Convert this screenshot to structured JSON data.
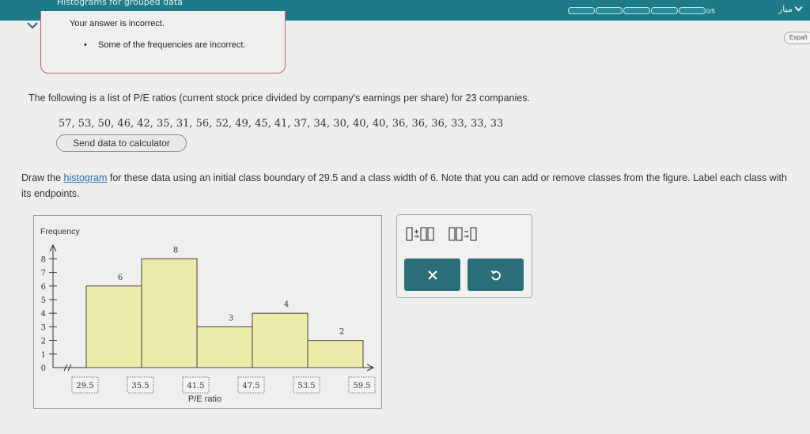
{
  "header": {
    "title": "Histograms for grouped data",
    "progress": {
      "label": "0/5",
      "completed": 0,
      "total": 5
    },
    "language_select": "ميار",
    "espanol_button": "Españ"
  },
  "feedback": {
    "title": "Your answer is incorrect.",
    "items": [
      "Some of the frequencies are incorrect."
    ]
  },
  "problem": {
    "intro": "The following is a list of P/E ratios (current stock price divided by company's earnings per share) for 23 companies.",
    "data": "57, 53, 50, 46, 42, 35, 31, 56, 52, 49, 45, 41, 37, 34, 30, 40, 40, 36, 36, 36, 33, 33, 33",
    "send_button": "Send data to calculator",
    "instruction_pre": "Draw the ",
    "instruction_link": "histogram",
    "instruction_post": " for these data using an initial class boundary of 29.5 and a class width of 6. Note that you can add or remove classes from the figure. Label each class with its endpoints."
  },
  "chart_data": {
    "type": "bar",
    "ylabel": "Frequency",
    "xlabel": "P/E ratio",
    "boundaries": [
      "29.5",
      "35.5",
      "41.5",
      "47.5",
      "53.5",
      "59.5"
    ],
    "values": [
      6,
      8,
      3,
      4,
      2
    ],
    "y_ticks": [
      0,
      1,
      2,
      3,
      4,
      5,
      6,
      7,
      8
    ],
    "ylim": [
      0,
      8.5
    ],
    "bar_color": "#ecebaa"
  },
  "tools": {
    "clear_icon": "x-icon",
    "undo_icon": "undo-icon",
    "accent_color": "#2d6e7b"
  }
}
